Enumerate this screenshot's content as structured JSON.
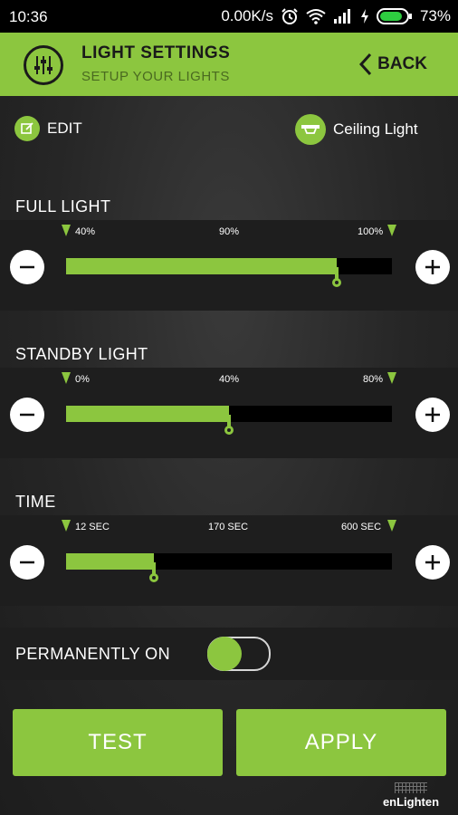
{
  "status_bar": {
    "time": "10:36",
    "speed": "0.00K/s",
    "battery": "73%",
    "icons": [
      "alarm-icon",
      "wifi-icon",
      "signal-icon",
      "charging-icon",
      "battery-icon"
    ]
  },
  "header": {
    "title": "LIGHT SETTINGS",
    "subtitle": "SETUP YOUR LIGHTS",
    "back_label": "BACK",
    "accent": "#8cc63f"
  },
  "toolbar": {
    "edit_label": "EDIT",
    "light_name": "Ceiling Light"
  },
  "sliders": [
    {
      "title": "FULL LIGHT",
      "min_label": "40%",
      "mid_label": "90%",
      "max_label": "100%",
      "fill_fraction": 0.83
    },
    {
      "title": "STANDBY LIGHT",
      "min_label": "0%",
      "mid_label": "40%",
      "max_label": "80%",
      "fill_fraction": 0.5
    },
    {
      "title": "TIME",
      "min_label": "12 SEC",
      "mid_label": "170 SEC",
      "max_label": "600 SEC",
      "fill_fraction": 0.27
    }
  ],
  "permanent": {
    "label": "PERMANENTLY ON",
    "state": "off"
  },
  "actions": {
    "test_label": "TEST",
    "apply_label": "APPLY"
  },
  "brand": "enLighten"
}
